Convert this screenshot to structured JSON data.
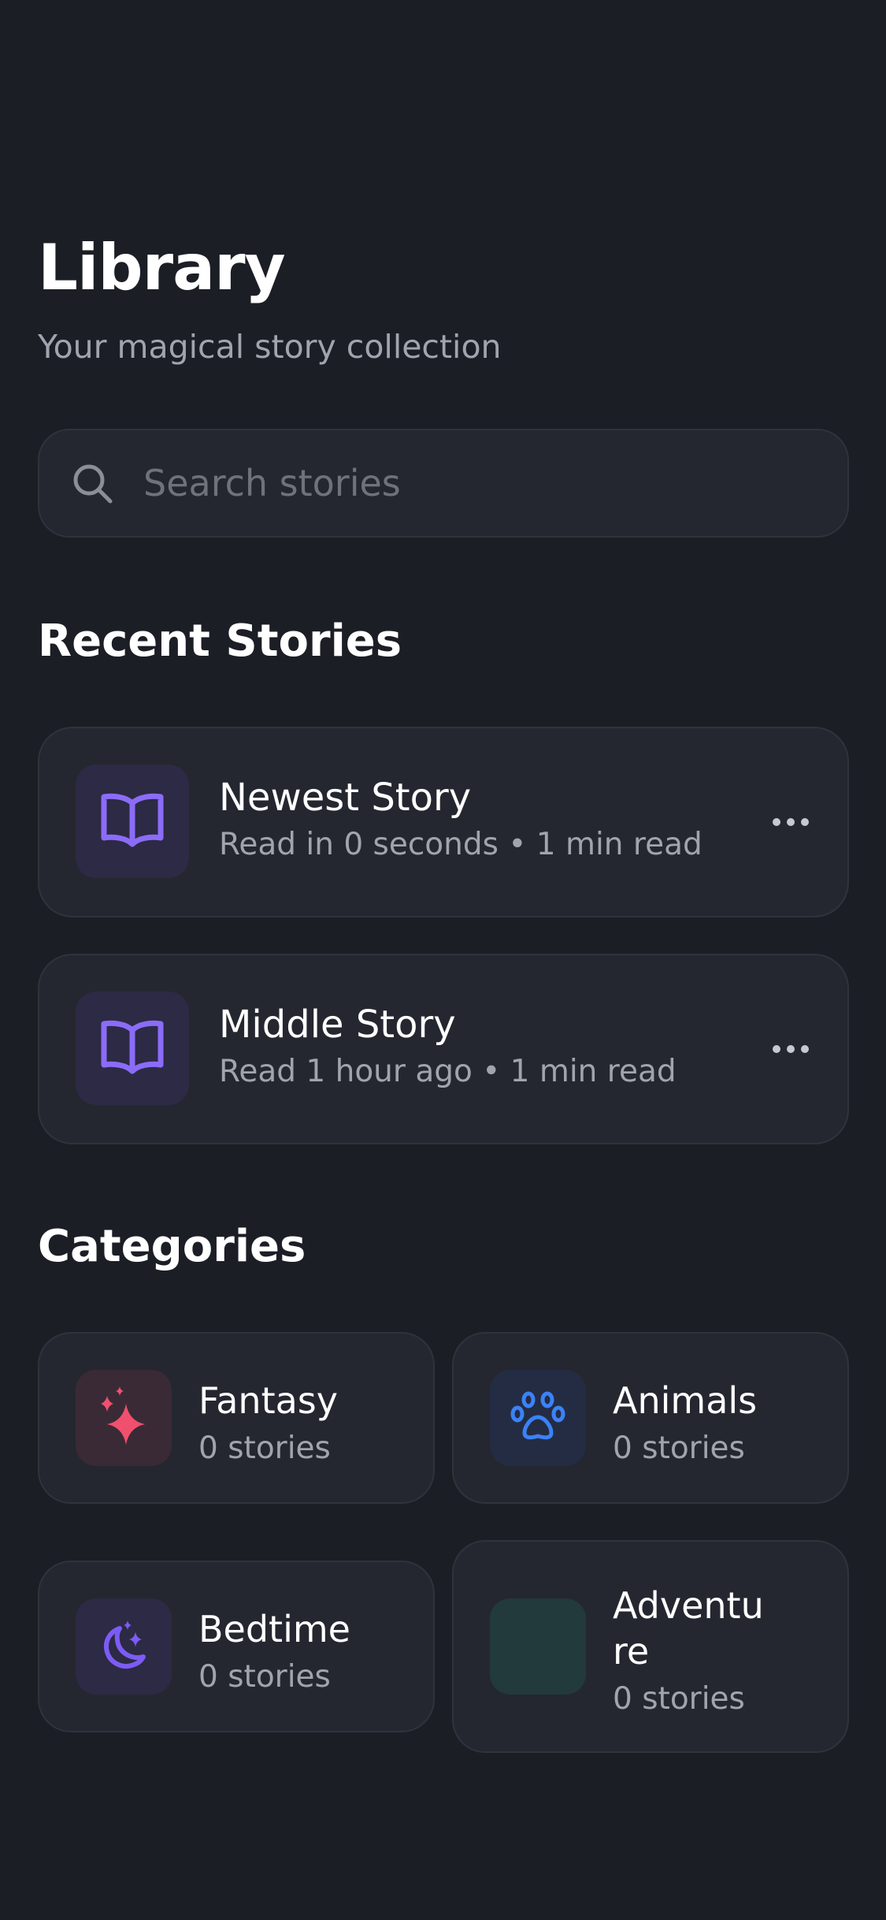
{
  "header": {
    "title": "Library",
    "subtitle": "Your magical story collection"
  },
  "search": {
    "placeholder": "Search stories",
    "value": ""
  },
  "recent": {
    "title": "Recent Stories",
    "items": [
      {
        "title": "Newest Story",
        "meta": "Read in 0 seconds • 1 min read",
        "icon": "open-book-icon"
      },
      {
        "title": "Middle Story",
        "meta": "Read 1 hour ago • 1 min read",
        "icon": "open-book-icon"
      }
    ]
  },
  "categories": {
    "title": "Categories",
    "items": [
      {
        "name": "Fantasy",
        "count": "0 stories",
        "icon": "sparkles-icon",
        "color": "#f0506e"
      },
      {
        "name": "Animals",
        "count": "0 stories",
        "icon": "paw-icon",
        "color": "#3b82f6"
      },
      {
        "name": "Bedtime",
        "count": "0 stories",
        "icon": "moon-stars-icon",
        "color": "#7c5cf5"
      },
      {
        "name": "Adventure",
        "count": "0 stories",
        "icon": "",
        "color": "#1f3a3a"
      }
    ]
  },
  "colors": {
    "background": "#1c1e26",
    "card": "#252730",
    "accent": "#7c5cf5",
    "muted_text": "#a1a4ae"
  }
}
